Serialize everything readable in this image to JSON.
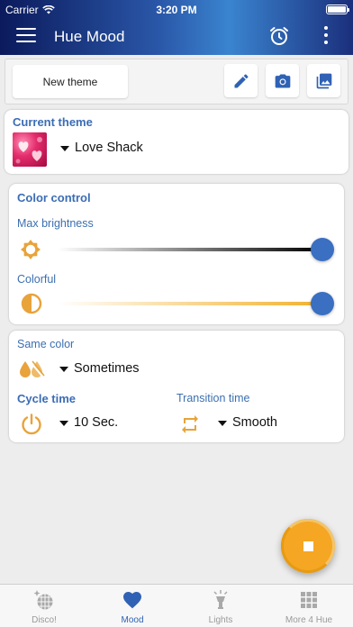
{
  "status_bar": {
    "carrier": "Carrier",
    "time": "3:20 PM"
  },
  "appbar": {
    "title": "Hue Mood"
  },
  "toolbar": {
    "new_theme_label": "New theme"
  },
  "current_theme": {
    "label": "Current theme",
    "value": "Love Shack"
  },
  "color_control": {
    "label": "Color control",
    "max_brightness_label": "Max brightness",
    "max_brightness_level": 1.0,
    "colorful_label": "Colorful",
    "colorful_level": 1.0
  },
  "same_color": {
    "label": "Same color",
    "value": "Sometimes"
  },
  "cycle_time": {
    "label": "Cycle time",
    "value": "10 Sec."
  },
  "transition_time": {
    "label": "Transition time",
    "value": "Smooth"
  },
  "tabs": [
    {
      "label": "Disco!",
      "icon": "disco-ball-icon",
      "active": false
    },
    {
      "label": "Mood",
      "icon": "heart-icon",
      "active": true
    },
    {
      "label": "Lights",
      "icon": "lamp-icon",
      "active": false
    },
    {
      "label": "More 4 Hue",
      "icon": "grid-icon",
      "active": false
    }
  ],
  "colors": {
    "accent": "#3a6fc2",
    "label_blue": "#3c6fb0",
    "orange": "#f5a623",
    "icon_orange": "#e8a33a"
  }
}
